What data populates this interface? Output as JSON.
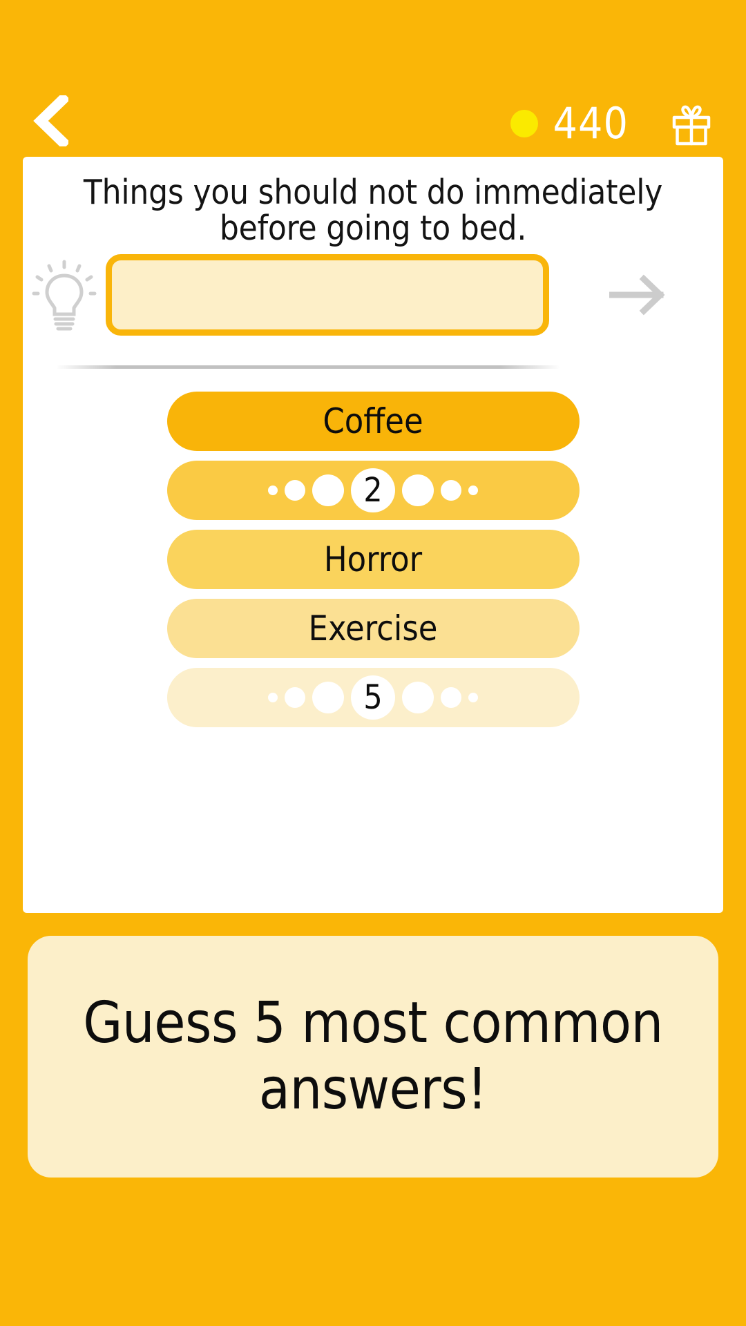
{
  "theme": {
    "page_background": "#FAB607",
    "card_background": "#FFFFFF",
    "coin_color": "#FAEA00",
    "accent": "#F9B50A",
    "input_fill": "#FDEFC8",
    "banner_background": "#FCEFC9",
    "text_color": "#0D0D0D"
  },
  "header": {
    "back_icon": "chevron-left-icon",
    "coin_icon": "coin-icon",
    "coin_count": "440",
    "gift_icon": "gift-icon"
  },
  "main": {
    "question": "Things you should not do immediately before going to bed.",
    "hint_icon": "lightbulb-icon",
    "input": {
      "value": "",
      "placeholder": ""
    },
    "submit_icon": "arrow-right-icon",
    "answers": [
      {
        "rank": 1,
        "label": "Coffee",
        "revealed": true,
        "color": "#F9B409"
      },
      {
        "rank": 2,
        "label": "2",
        "revealed": false,
        "color": "#FACA44"
      },
      {
        "rank": 3,
        "label": "Horror",
        "revealed": true,
        "color": "#FAD35C"
      },
      {
        "rank": 4,
        "label": "Exercise",
        "revealed": true,
        "color": "#FBE093"
      },
      {
        "rank": 5,
        "label": "5",
        "revealed": false,
        "color": "#FCEFCB"
      }
    ]
  },
  "banner": {
    "text": "Guess 5 most common answers!"
  }
}
